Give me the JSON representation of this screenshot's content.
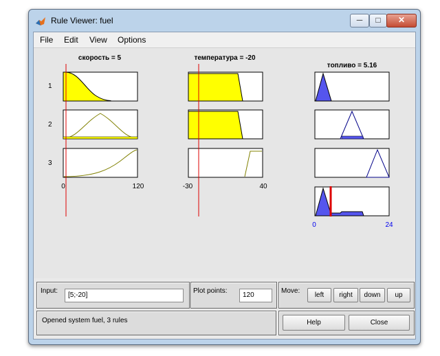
{
  "window": {
    "title": "Rule Viewer: fuel",
    "min_glyph": "─",
    "max_glyph": "□",
    "close_glyph": "✕"
  },
  "menu": {
    "items": [
      "File",
      "Edit",
      "View",
      "Options"
    ]
  },
  "inputs": [
    {
      "name": "скорость",
      "title": "скорость = 5",
      "range": [
        0,
        120
      ],
      "range_labels": [
        "0",
        "120"
      ],
      "value": 5
    },
    {
      "name": "температура",
      "title": "температура = -20",
      "range": [
        -30,
        40
      ],
      "range_labels": [
        "-30",
        "40"
      ],
      "value": -20
    }
  ],
  "output": {
    "name": "топливо",
    "title": "топливо = 5.16",
    "range": [
      0,
      24
    ],
    "range_labels": [
      "0",
      "24"
    ],
    "value": 5.16
  },
  "rules": [
    {
      "number": "1",
      "speed_mf": "zmf low",
      "temp_mf": "trapezoid low",
      "fuel_mf": "triangle low",
      "firing": 1.0
    },
    {
      "number": "2",
      "speed_mf": "gauss mid",
      "temp_mf": "trapezoid low",
      "fuel_mf": "triangle mid",
      "firing": 0.05
    },
    {
      "number": "3",
      "speed_mf": "smf high",
      "temp_mf": "trapezoid high",
      "fuel_mf": "triangle high",
      "firing": 0.0
    }
  ],
  "controls": {
    "input_label": "Input:",
    "input_value": "[5;-20]",
    "plot_points_label": "Plot points:",
    "plot_points_value": "120",
    "move_label": "Move:",
    "move_buttons": [
      "left",
      "right",
      "down",
      "up"
    ],
    "help_label": "Help",
    "close_label": "Close",
    "status_text": "Opened system fuel, 3 rules"
  },
  "colors": {
    "fill": "#ffff00",
    "mf_line": "#808000",
    "output_fill": "#5555ee",
    "indicator": "#dd0000",
    "axis_label_blue": "#0000ee"
  }
}
